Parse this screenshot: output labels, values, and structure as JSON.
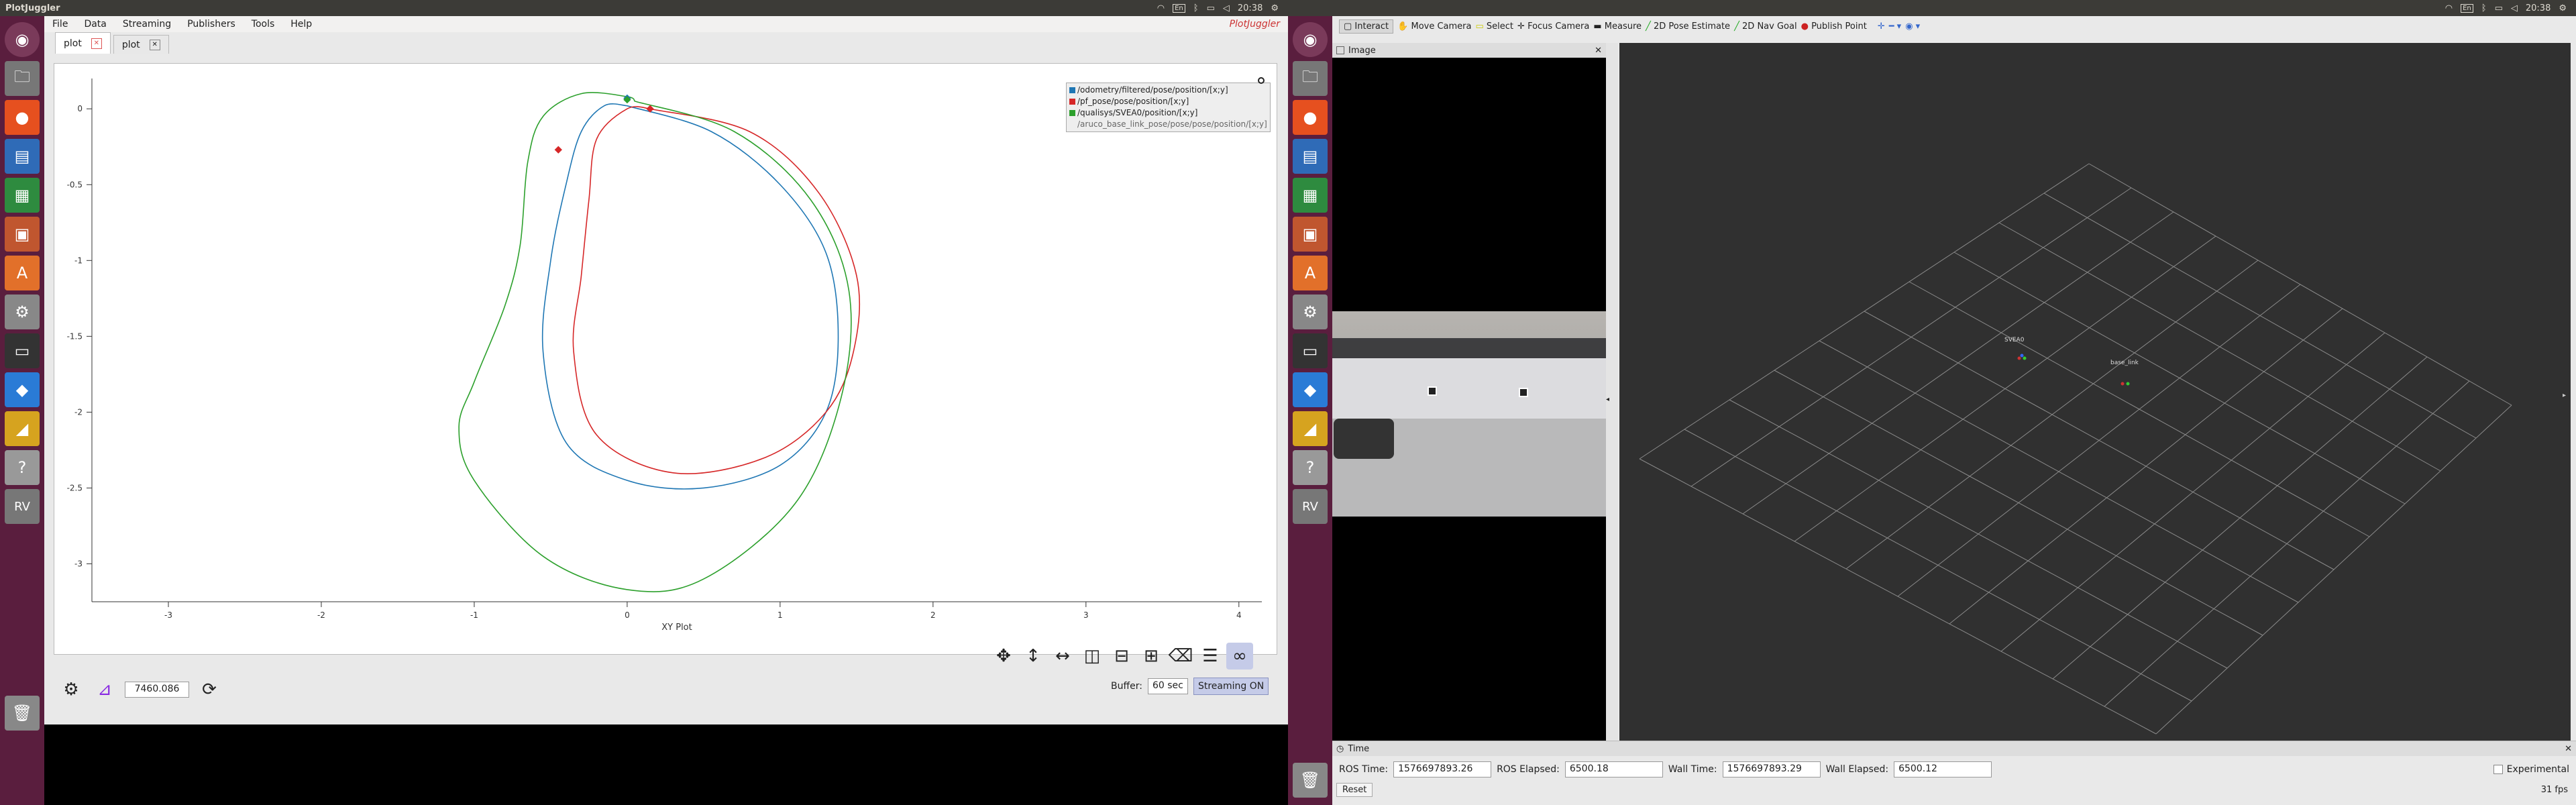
{
  "left_window": {
    "title": "PlotJuggler",
    "brand": "PlotJuggler",
    "clock": "20:38",
    "menu": [
      "File",
      "Data",
      "Streaming",
      "Publishers",
      "Tools",
      "Help"
    ],
    "tabs": [
      {
        "label": "plot"
      },
      {
        "label": "plot"
      }
    ],
    "plot": {
      "xlabel": "XY Plot",
      "legend": [
        {
          "label": "/odometry/filtered/pose/position/[x;y]",
          "color": "#1f77b4"
        },
        {
          "label": "/pf_pose/pose/position/[x;y]",
          "color": "#d62728"
        },
        {
          "label": "/qualisys/SVEA0/position/[x;y]",
          "color": "#2ca02c"
        },
        {
          "label": "/aruco_base_link_pose/pose/pose/position/[x;y]",
          "color": "#888888"
        }
      ]
    },
    "bottom": {
      "time_value": "7460.086",
      "buffer_label": "Buffer:",
      "buffer_value": "60 sec",
      "streaming_label": "Streaming ON"
    }
  },
  "chart_data": {
    "type": "scatter",
    "xlabel": "XY Plot",
    "xlim": [
      -3.5,
      4.15
    ],
    "ylim": [
      -3.25,
      0.2
    ],
    "xticks": [
      -3,
      -2,
      -1,
      0,
      1,
      2,
      3,
      4
    ],
    "yticks": [
      0,
      -0.5,
      -1,
      -1.5,
      -2,
      -2.5,
      -3
    ],
    "series": [
      {
        "name": "/odometry/filtered/pose/position/[x;y]",
        "color": "#1f77b4",
        "x": [
          0.0,
          0.55,
          1.0,
          1.3,
          1.38,
          1.3,
          1.0,
          0.5,
          0.0,
          -0.4,
          -0.55,
          -0.5,
          -0.4,
          -0.3,
          -0.15,
          0.0
        ],
        "y": [
          0.02,
          -0.15,
          -0.5,
          -0.95,
          -1.5,
          -2.0,
          -2.35,
          -2.5,
          -2.45,
          -2.2,
          -1.6,
          -1.0,
          -0.5,
          -0.15,
          0.02,
          0.02
        ]
      },
      {
        "name": "/pf_pose/pose/position/[x;y]",
        "color": "#d62728",
        "x": [
          0.15,
          0.8,
          1.25,
          1.5,
          1.48,
          1.3,
          0.9,
          0.3,
          -0.2,
          -0.35,
          -0.3,
          -0.25,
          -0.2,
          0.0,
          0.15
        ],
        "y": [
          0.0,
          -0.15,
          -0.55,
          -1.1,
          -1.6,
          -2.0,
          -2.3,
          -2.4,
          -2.15,
          -1.6,
          -1.1,
          -0.6,
          -0.2,
          0.0,
          0.0
        ]
      },
      {
        "name": "/qualisys/SVEA0/position/[x;y]",
        "color": "#2ca02c",
        "x": [
          0.05,
          0.7,
          1.2,
          1.45,
          1.4,
          1.1,
          0.5,
          0.0,
          -0.55,
          -1.0,
          -1.1,
          -1.0,
          -0.8,
          -0.7,
          -0.65,
          -0.55,
          -0.3,
          0.0,
          0.05
        ],
        "y": [
          0.05,
          -0.15,
          -0.6,
          -1.2,
          -1.9,
          -2.6,
          -3.1,
          -3.17,
          -2.95,
          -2.45,
          -2.1,
          -1.8,
          -1.3,
          -0.9,
          -0.35,
          -0.05,
          0.1,
          0.08,
          0.05
        ]
      }
    ],
    "markers": [
      {
        "x": 0.0,
        "y": 0.07,
        "color": "#1f77b4"
      },
      {
        "x": 0.15,
        "y": 0.0,
        "color": "#d62728"
      },
      {
        "x": -0.45,
        "y": -0.27,
        "color": "#d62728"
      },
      {
        "x": 0.0,
        "y": 0.06,
        "color": "#2ca02c"
      }
    ]
  },
  "right_window": {
    "clock": "20:38",
    "toolbar": [
      "Interact",
      "Move Camera",
      "Select",
      "Focus Camera",
      "Measure",
      "2D Pose Estimate",
      "2D Nav Goal",
      "Publish Point"
    ],
    "image_panel_title": "Image",
    "frame_labels": [
      "SVEA0",
      "base_link"
    ],
    "time_panel": {
      "title": "Time",
      "ros_time_label": "ROS Time:",
      "ros_time": "1576697893.26",
      "ros_elapsed_label": "ROS Elapsed:",
      "ros_elapsed": "6500.18",
      "wall_time_label": "Wall Time:",
      "wall_time": "1576697893.29",
      "wall_elapsed_label": "Wall Elapsed:",
      "wall_elapsed": "6500.12",
      "experimental": "Experimental",
      "reset": "Reset",
      "fps": "31 fps"
    }
  }
}
